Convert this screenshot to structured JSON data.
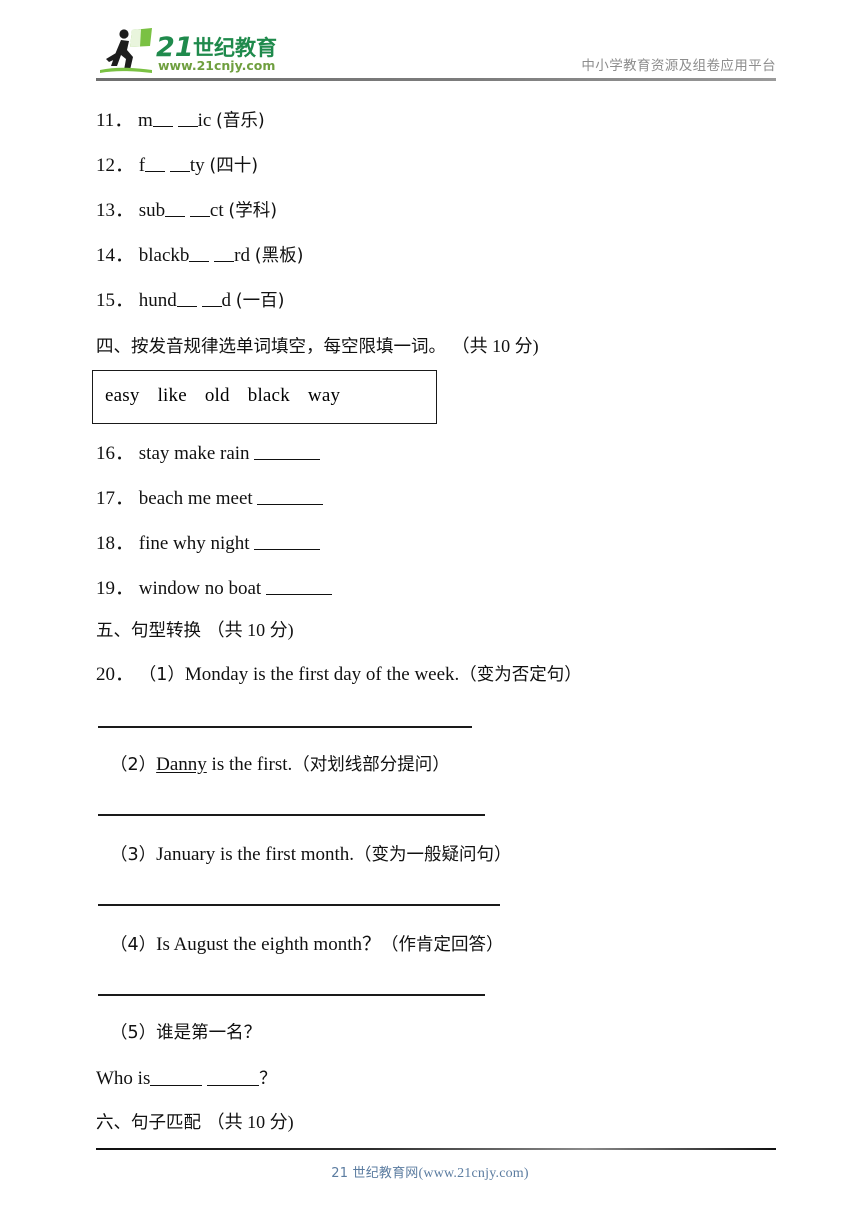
{
  "header": {
    "logo_brand": "21世纪教育",
    "logo_url": "www.21cnjy.com",
    "tagline": "中小学教育资源及组卷应用平台",
    "logo_colors": {
      "green_dark": "#1f8a4c",
      "green_light": "#7ac143",
      "gray": "#7a7a7a"
    }
  },
  "vocab_items": [
    {
      "num": "11．",
      "pre": "m",
      "mid": "",
      "post": "ic",
      "gloss": "(音乐)"
    },
    {
      "num": "12．",
      "pre": "f",
      "mid": "",
      "post": "ty",
      "gloss": "(四十)"
    },
    {
      "num": "13．",
      "pre": "sub",
      "mid": "",
      "post": "ct",
      "gloss": "(学科)"
    },
    {
      "num": "14．",
      "pre": "blackb",
      "mid": "",
      "post": "rd",
      "gloss": "(黑板)"
    },
    {
      "num": "15．",
      "pre": "hund",
      "mid": "",
      "post": "d",
      "gloss": "(一百)"
    }
  ],
  "section_four": {
    "heading_cn": "四、按发音规律选单词填空，每空限填一词。",
    "points": "（共 10 分)",
    "wordbank": [
      "easy",
      "like",
      "old",
      "black",
      "way"
    ],
    "items": [
      {
        "num": "16．",
        "words": "stay  make  rain"
      },
      {
        "num": "17．",
        "words": "beach  me  meet"
      },
      {
        "num": "18．",
        "words": "fine  why  night"
      },
      {
        "num": "19．",
        "words": "window  no  boat"
      }
    ]
  },
  "section_five": {
    "heading_cn": "五、句型转换",
    "points": "（共 10 分)",
    "qnum": "20．",
    "subitems": [
      {
        "label": "（1）",
        "text": "Monday is the first day of the week.",
        "instruction": "（变为否定句）"
      },
      {
        "label": "（2）",
        "underlined": "Danny",
        "text": " is the first.",
        "instruction": "（对划线部分提问）"
      },
      {
        "label": "（3）",
        "text": "January is the first month.",
        "instruction": "（变为一般疑问句）"
      },
      {
        "label": "（4）",
        "text": "Is August the eighth month？",
        "instruction": "（作肯定回答）"
      },
      {
        "label": "（5）",
        "text": "谁是第一名？",
        "instruction": ""
      }
    ],
    "answer_prompt_pre": "Who is",
    "answer_prompt_post": "？"
  },
  "section_six": {
    "heading_cn": "六、句子匹配",
    "points": "（共 10 分)"
  },
  "footer": {
    "brand_cn": "21 世纪教育网",
    "url": "(www.21cnjy.com)",
    "color": "#5b7ca0"
  }
}
